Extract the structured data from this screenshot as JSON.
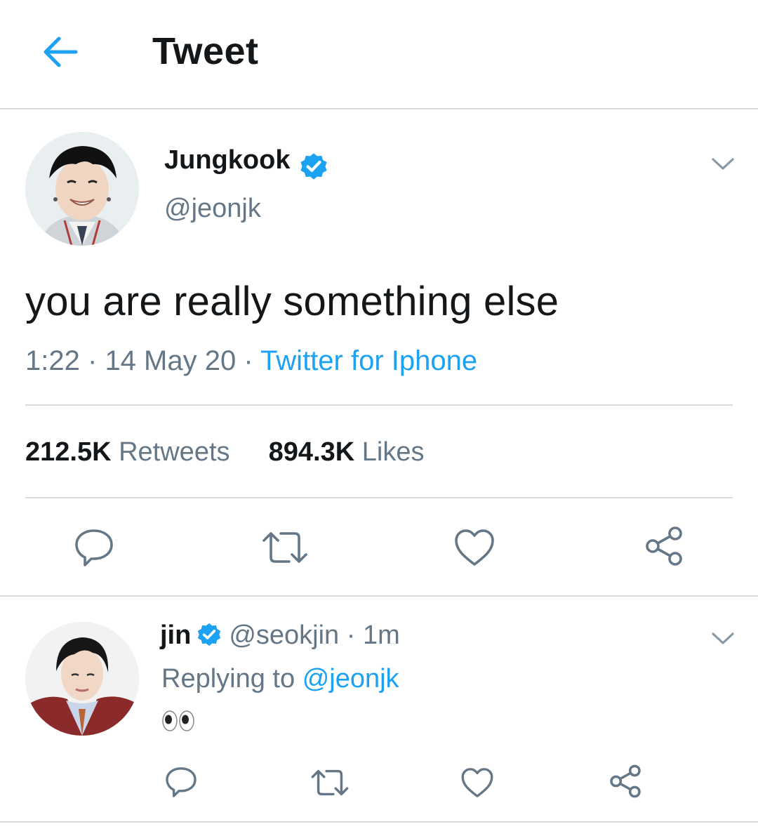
{
  "header": {
    "title": "Tweet",
    "back_icon": "arrow-left-icon"
  },
  "tweet": {
    "author_name": "Jungkook",
    "author_handle": "@jeonjk",
    "verified": true,
    "text": "you are really something else",
    "time": "1:22",
    "date": "14 May 20",
    "separator": "·",
    "source": "Twitter for Iphone",
    "retweets_count": "212.5K",
    "retweets_label": "Retweets",
    "likes_count": "894.3K",
    "likes_label": "Likes",
    "actions": [
      "reply-icon",
      "retweet-icon",
      "like-icon",
      "share-icon"
    ]
  },
  "reply": {
    "author_name": "jin",
    "author_handle": "@seokjin",
    "separator": "·",
    "time": "1m",
    "replying_prefix": "Replying to",
    "replying_handle": "@jeonjk",
    "content_emoji": "eyes-emoji",
    "actions": [
      "reply-icon",
      "retweet-icon",
      "like-icon",
      "share-icon"
    ]
  },
  "colors": {
    "accent": "#1da1f2",
    "text": "#14171a",
    "secondary": "#657786",
    "divider": "#d6dbe0"
  }
}
